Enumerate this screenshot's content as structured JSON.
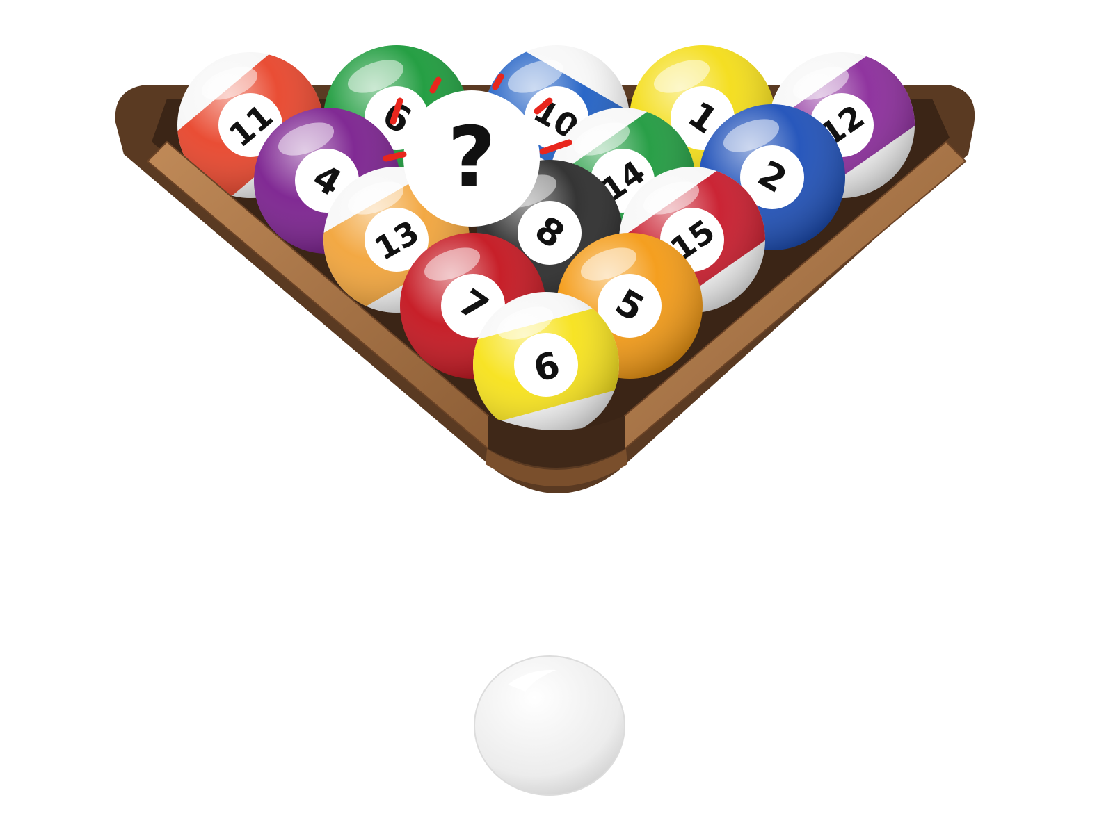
{
  "mystery_ball": {
    "label": "?",
    "color": "#ffffff",
    "marks_color": "#e8261d"
  },
  "balls": [
    {
      "number": "11",
      "color": "#e8442a",
      "style": "stripe",
      "tilt": -40
    },
    {
      "number": "6",
      "color": "#1a9a3a",
      "style": "solid",
      "tilt": 30
    },
    {
      "number": "10",
      "color": "#1f5fc4",
      "style": "stripe",
      "tilt": 30
    },
    {
      "number": "1",
      "color": "#f4dd17",
      "style": "solid",
      "tilt": 35
    },
    {
      "number": "12",
      "color": "#8a2a9a",
      "style": "stripe",
      "tilt": -35
    },
    {
      "number": "4",
      "color": "#7a1f8e",
      "style": "solid",
      "tilt": 30
    },
    {
      "number": "14",
      "color": "#1e9a3e",
      "style": "stripe",
      "tilt": -35
    },
    {
      "number": "2",
      "color": "#1d4fb8",
      "style": "solid",
      "tilt": 30
    },
    {
      "number": "13",
      "color": "#f2a43a",
      "style": "stripe",
      "tilt": -30
    },
    {
      "number": "8",
      "color": "#2a2a2a",
      "style": "solid",
      "tilt": 35
    },
    {
      "number": "15",
      "color": "#c8192a",
      "style": "stripe",
      "tilt": -35
    },
    {
      "number": "7",
      "color": "#c4141e",
      "style": "solid",
      "tilt": 35
    },
    {
      "number": "5",
      "color": "#f49a14",
      "style": "solid",
      "tilt": 30
    },
    {
      "number": "9",
      "color": "#f7e21a",
      "style": "stripe",
      "tilt": 165
    }
  ],
  "cue_ball": {
    "color": "#f4f4f4"
  },
  "rack": {
    "wood_color": "#a9774a",
    "dark_color": "#4a2f1e"
  }
}
